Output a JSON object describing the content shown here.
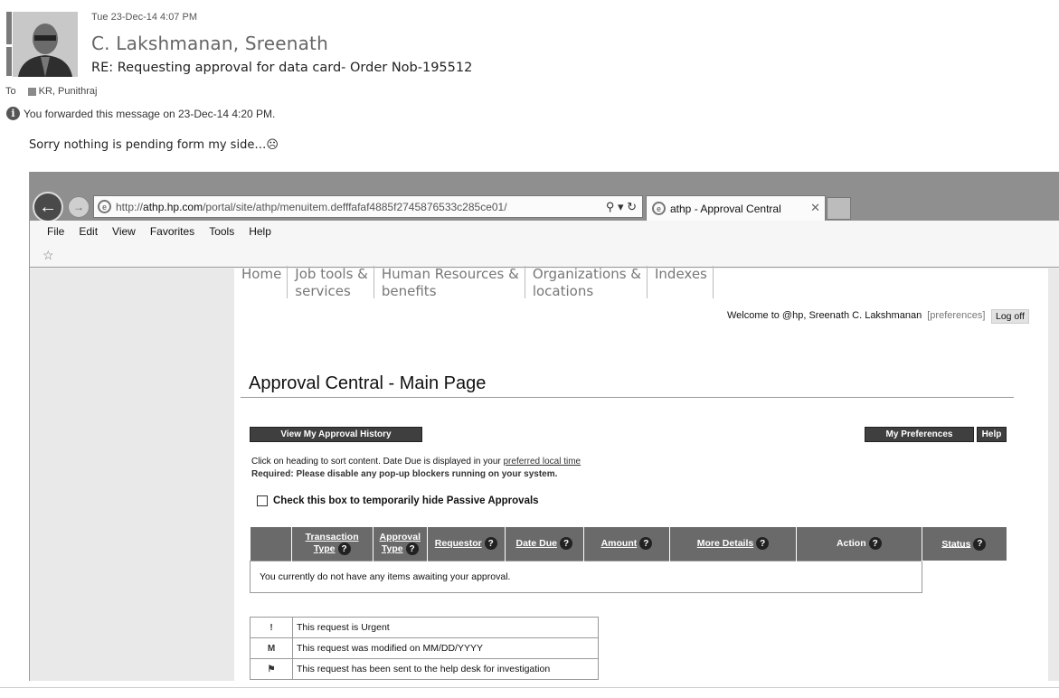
{
  "email": {
    "date": "Tue 23-Dec-14 4:07 PM",
    "sender": "C. Lakshmanan, Sreenath",
    "subject": "RE: Requesting approval for data card- Order Nob-195512",
    "to_label": "To",
    "to_name": "KR, Punithraj",
    "forward_note": "You forwarded this message on 23-Dec-14 4:20 PM.",
    "body": "Sorry nothing is pending form my side…☹"
  },
  "browser": {
    "url_prefix": "http://",
    "url_domain": "athp.hp.com",
    "url_path": "/portal/site/athp/menuitem.defffafaf4885f2745876533c285ce01/",
    "tab_title": "athp - Approval Central",
    "menu": [
      "File",
      "Edit",
      "View",
      "Favorites",
      "Tools",
      "Help"
    ]
  },
  "portal": {
    "nav": [
      {
        "line1": "Home",
        "line2": ""
      },
      {
        "line1": "Job tools &",
        "line2": "services"
      },
      {
        "line1": "Human Resources &",
        "line2": "benefits"
      },
      {
        "line1": "Organizations &",
        "line2": "locations"
      },
      {
        "line1": "Indexes",
        "line2": ""
      }
    ],
    "welcome": "Welcome to @hp, Sreenath C. Lakshmanan",
    "preferences_link": "[preferences]",
    "logoff": "Log off",
    "page_title": "Approval Central - Main Page",
    "history_button": "View My Approval History",
    "my_prefs_button": "My Preferences",
    "help_button": "Help",
    "help_line1_pre": "Click on heading to sort content. Date Due is displayed in your ",
    "help_line1_link": "preferred local time",
    "help_line2": "Required: Please disable any pop-up blockers running on your system.",
    "checkbox_label": "Check this box to temporarily hide Passive Approvals",
    "columns": [
      {
        "line1": "Transaction",
        "line2": "Type"
      },
      {
        "line1": "Approval",
        "line2": "Type"
      },
      {
        "line1": "Requestor",
        "line2": ""
      },
      {
        "line1": "Date Due",
        "line2": ""
      },
      {
        "line1": "Amount",
        "line2": ""
      },
      {
        "line1": "More Details",
        "line2": ""
      },
      {
        "line1": "Action",
        "line2": ""
      },
      {
        "line1": "Status",
        "line2": ""
      }
    ],
    "empty_message": "You currently do not have any items awaiting your approval.",
    "legend": [
      {
        "symbol": "!",
        "text": "This request is Urgent"
      },
      {
        "symbol": "M",
        "text": "This request was modified on MM/DD/YYYY"
      },
      {
        "symbol": "⚑",
        "text": "This request has been sent to the help desk for investigation"
      }
    ]
  }
}
